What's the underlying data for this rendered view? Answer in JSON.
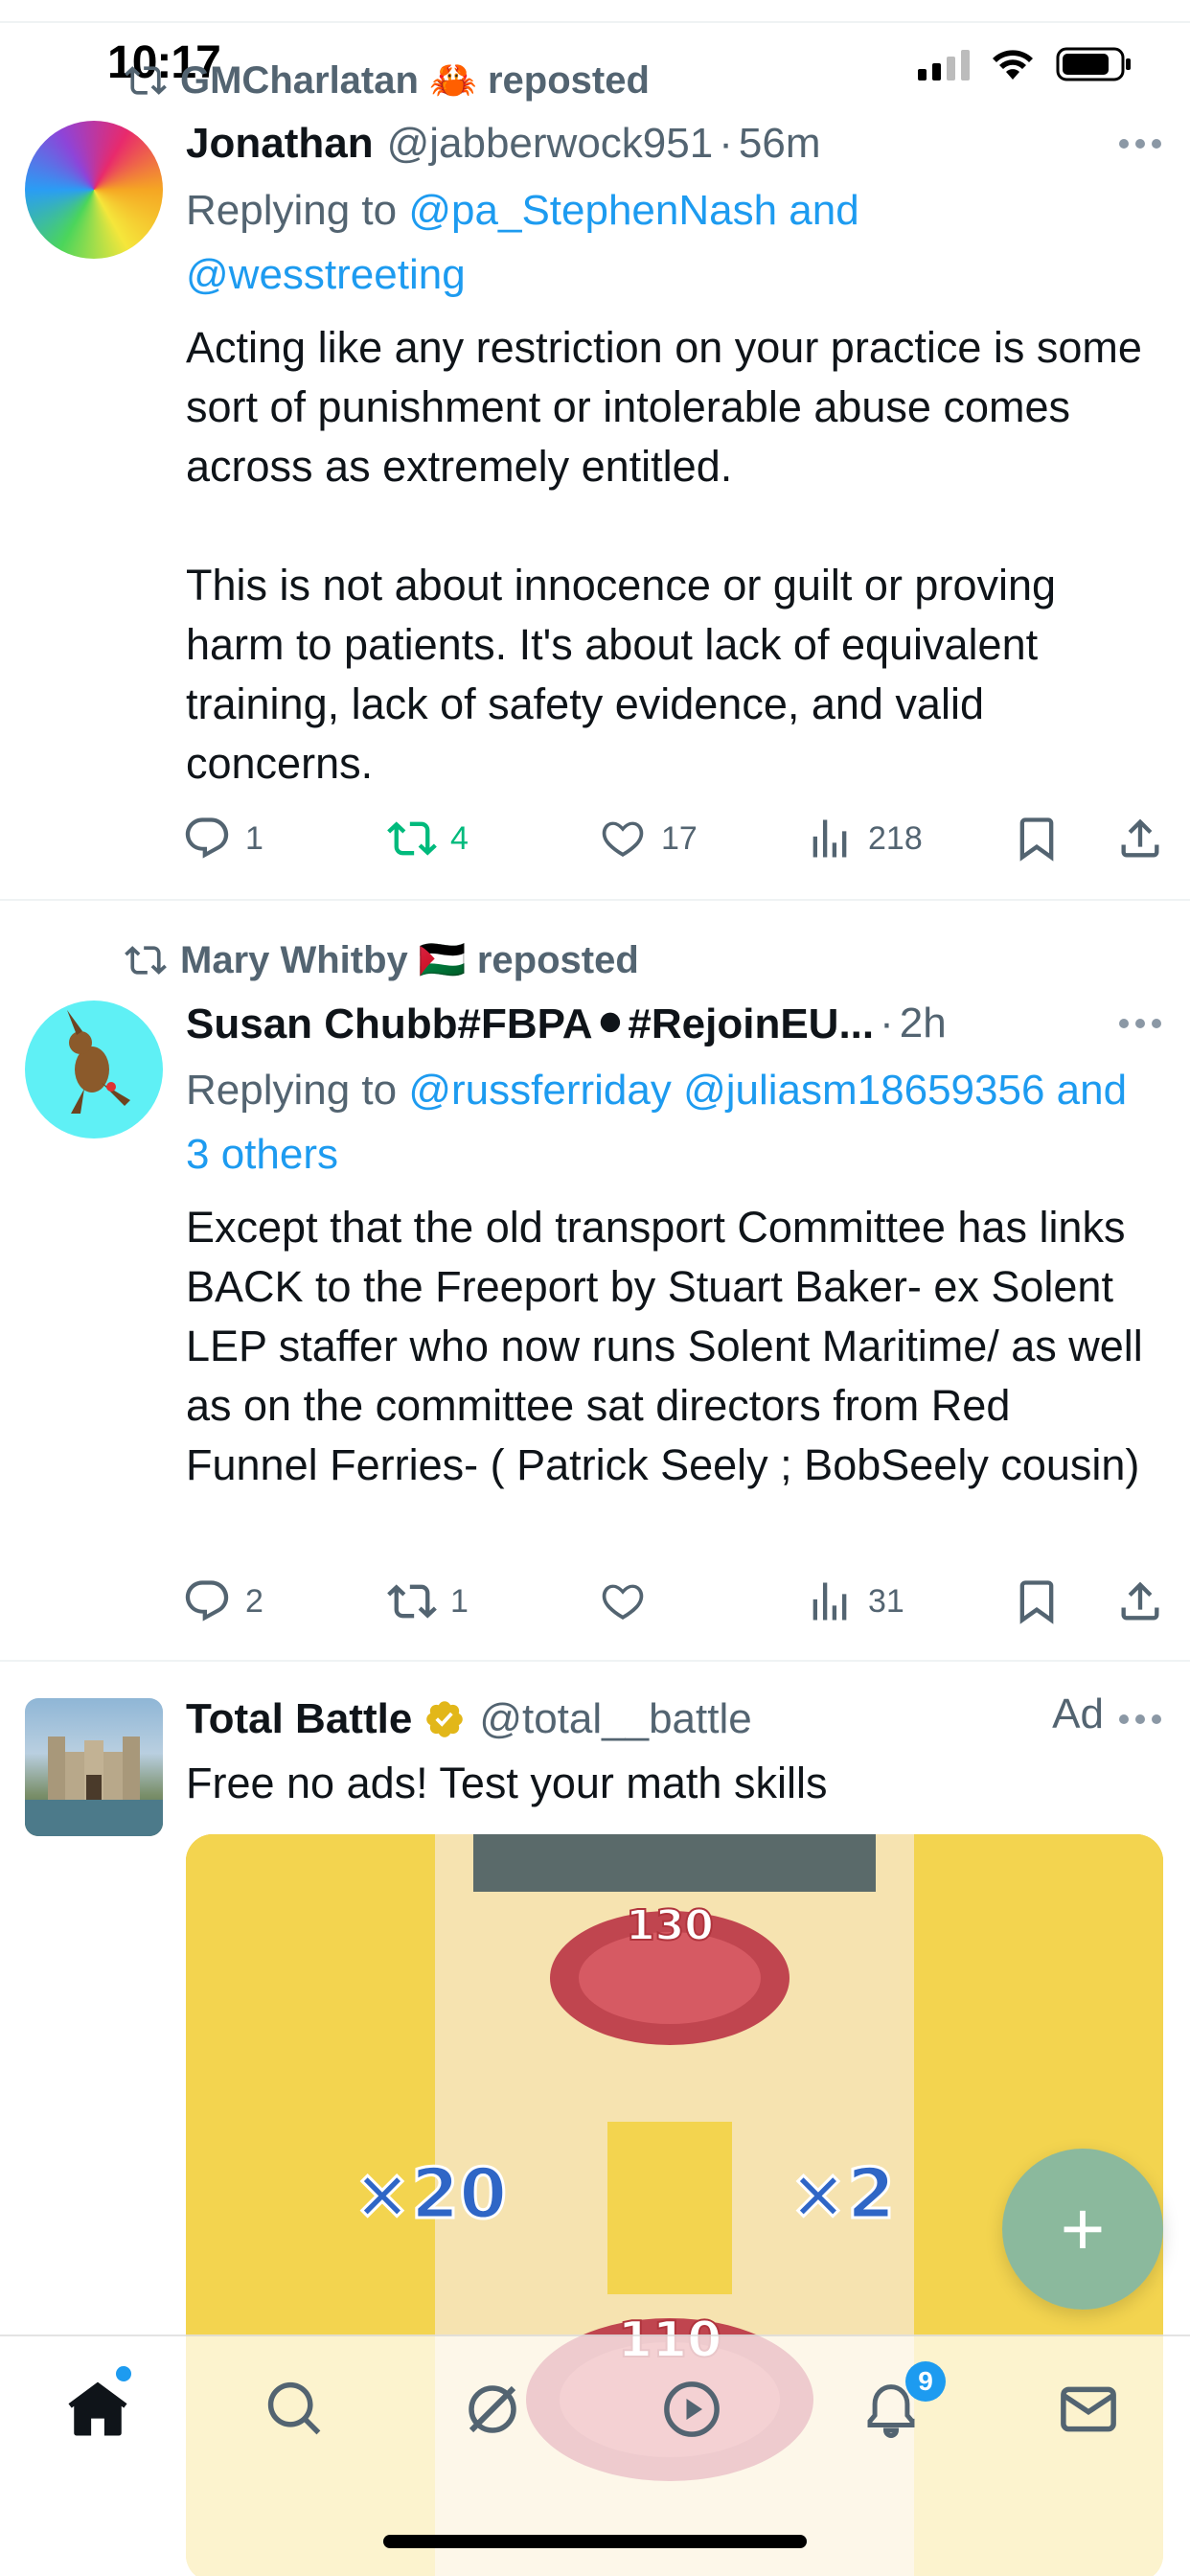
{
  "status_bar": {
    "time": "10:17"
  },
  "tweets": [
    {
      "repost_by": "GMCharlatan 🦀 reposted",
      "name": "Jonathan",
      "handle": "@jabberwock951",
      "time": "56m",
      "reply_prefix": "Replying to ",
      "reply_links": "@pa_StephenNash and @wesstreeting",
      "text": "Acting like any restriction on your practice is some sort of punishment or intolerable abuse comes across as extremely entitled.\n\nThis is not about innocence or guilt or proving harm to patients. It's about lack of equivalent training, lack of safety evidence, and valid concerns.",
      "replies": "1",
      "reposts": "4",
      "likes": "17",
      "views": "218"
    },
    {
      "repost_by": "Mary Whitby 🇵🇸 reposted",
      "name": "Susan Chubb#FBPA⚫#RejoinEU...",
      "time": "2h",
      "reply_prefix": "Replying to ",
      "reply_links": "@russferriday @juliasm18659356 and 3 others",
      "text": "Except that the old transport Committee  has links BACK to the Freeport by Stuart Baker- ex Solent LEP staffer who now runs Solent Maritime/ as well as on the committee sat directors from Red Funnel Ferries- ( Patrick Seely ; BobSeely cousin)",
      "replies": "2",
      "reposts": "1",
      "likes": "",
      "views": "31"
    }
  ],
  "ad": {
    "name": "Total Battle",
    "handle": "@total__battle",
    "ad_label": "Ad",
    "text": "Free no ads! Test your math skills",
    "media": {
      "top_count": "130",
      "left_gate": "×20",
      "right_gate": "×2",
      "bottom_count": "110"
    }
  },
  "tabbar": {
    "notifications_badge": "9"
  },
  "colors": {
    "link": "#1d9bf0",
    "muted": "#536471",
    "repost_green": "#00ba7c"
  }
}
